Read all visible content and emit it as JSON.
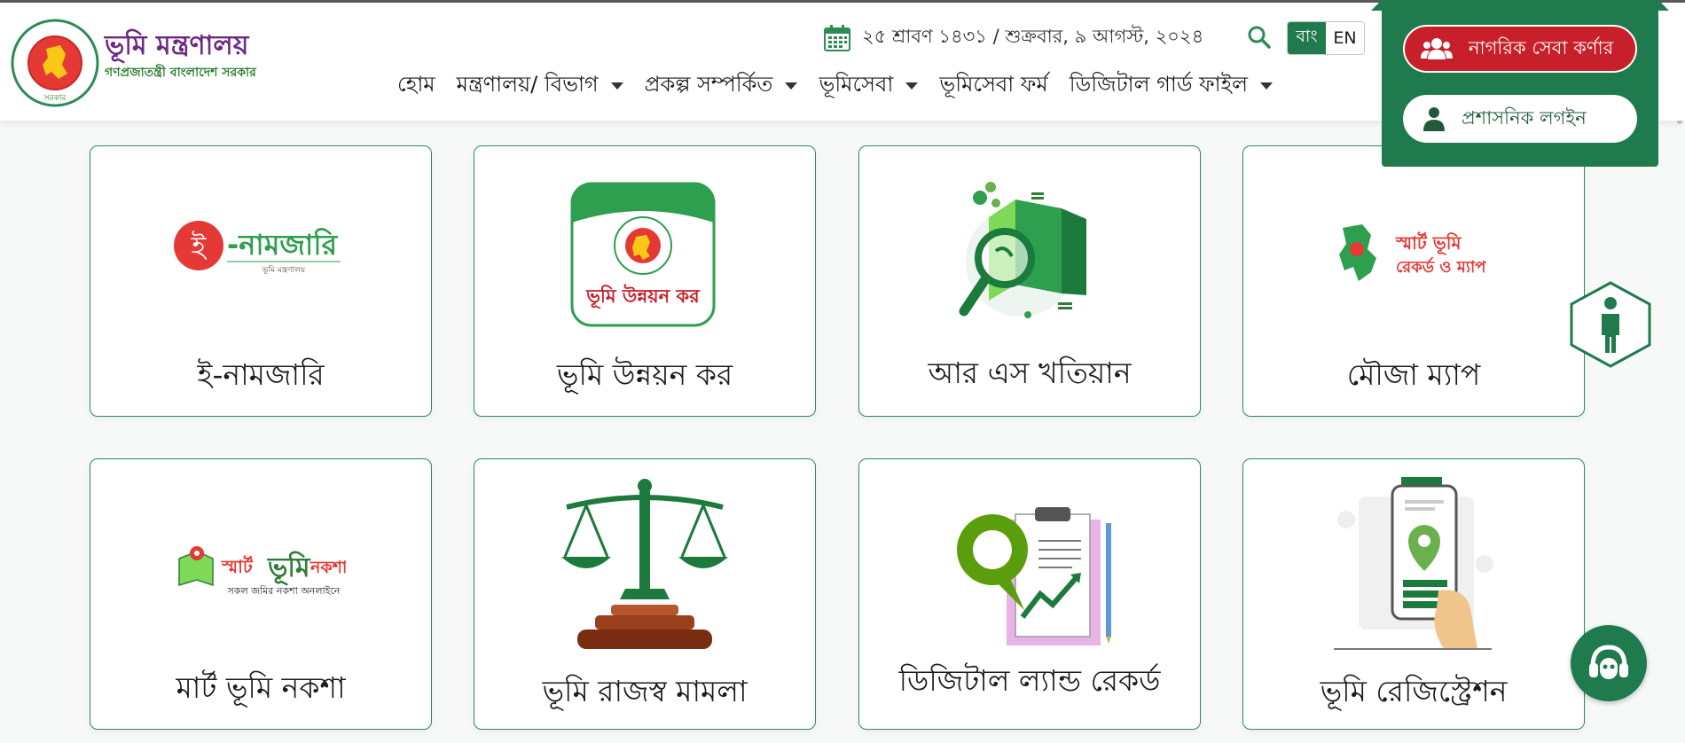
{
  "header": {
    "title": "ভূমি মন্ত্রণালয়",
    "subtitle": "গণপ্রজাতন্ত্রী বাংলাদেশ সরকার",
    "seal_text": "গণপ্রজাতন্ত্রী বাংলাদেশ সরকার",
    "date": "২৫ শ্রাবণ ১৪৩১ / শুক্রবার, ৯ আগস্ট, ২০২৪",
    "lang_bn": "বাং",
    "lang_en": "EN",
    "brand_color": "#1f7a4d"
  },
  "nav": [
    {
      "label": "হোম",
      "dropdown": false
    },
    {
      "label": "মন্ত্রণালয়/ বিভাগ",
      "dropdown": true
    },
    {
      "label": "প্রকল্প সম্পর্কিত",
      "dropdown": true
    },
    {
      "label": "ভূমিসেবা",
      "dropdown": true
    },
    {
      "label": "ভূমিসেবা ফর্ম",
      "dropdown": false
    },
    {
      "label": "ডিজিটাল গার্ড ফাইল",
      "dropdown": true
    }
  ],
  "login": {
    "citizen_label": "নাগরিক সেবা কর্ণার",
    "admin_label": "প্রশাসনিক লগইন"
  },
  "cards": [
    {
      "label": "ই-নামজারি",
      "logo_text": "-নামজারি",
      "logo_letter": "ই",
      "logo_sub": "ভূমি মন্ত্রণালয়"
    },
    {
      "label": "ভূমি উন্নয়ন কর",
      "logo_text": "ভূমি উন্নয়ন কর"
    },
    {
      "label": "আর এস খতিয়ান"
    },
    {
      "label": "মৌজা ম্যাপ",
      "logo_line1": "স্মার্ট ভূমি",
      "logo_line2": "রেকর্ড ও ম্যাপ"
    },
    {
      "label": "মার্ট ভূমি নকশা",
      "logo_line1": "স্মার্ট",
      "logo_line2": "ভূমি",
      "logo_line3": "নকশা",
      "logo_sub": "সকল জমির নকশা অনলাইনে"
    },
    {
      "label": "ভূমি রাজস্ব মামলা"
    },
    {
      "label": "ডিজিটাল ল্যান্ড রেকর্ড"
    },
    {
      "label": "ভূমি রেজিস্ট্রেশন"
    }
  ]
}
